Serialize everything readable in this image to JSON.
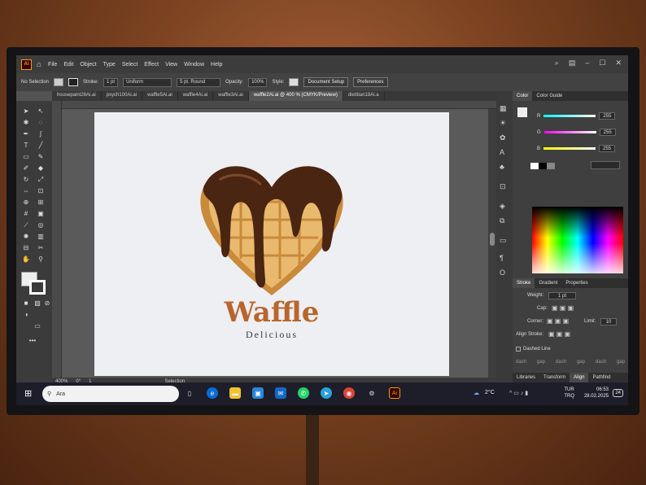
{
  "app": {
    "logo": "Ai"
  },
  "menu": [
    "File",
    "Edit",
    "Object",
    "Type",
    "Select",
    "Effect",
    "View",
    "Window",
    "Help"
  ],
  "control": {
    "selection": "No Selection",
    "stroke_label": "Stroke:",
    "stroke_value": "1 pt",
    "uniform": "Uniform",
    "brush": "5 pt. Round",
    "opacity_label": "Opacity:",
    "opacity_value": "100%",
    "style_label": "Style:",
    "doc_setup": "Document Setup",
    "preferences": "Preferences"
  },
  "tabs": [
    {
      "label": "housepaint26Ai.ai"
    },
    {
      "label": "psych100Ai.ai"
    },
    {
      "label": "waffle5Ai.ai"
    },
    {
      "label": "waffle4Ai.ai"
    },
    {
      "label": "waffle3Ai.ai"
    },
    {
      "label": "waffle2Ai.ai @ 400 % (CMYK/Preview)"
    },
    {
      "label": "dietitian18Ai.a"
    }
  ],
  "artwork": {
    "title": "Waffle",
    "subtitle": "Delicious",
    "colors": {
      "chocolate": "#4a2512",
      "waffle": "#e9b96e",
      "waffle_dark": "#c98a3c",
      "title": "#b8662e",
      "subtitle": "#3a3a3a"
    }
  },
  "color_panel": {
    "tabs": [
      "Color",
      "Color Guide"
    ],
    "r_label": "R",
    "g_label": "G",
    "b_label": "B",
    "r": "255",
    "g": "255",
    "b": "255"
  },
  "stroke_panel": {
    "tabs": [
      "Stroke",
      "Gradient",
      "Properties"
    ],
    "weight_label": "Weight:",
    "weight": "1 pt",
    "cap_label": "Cap:",
    "corner_label": "Corner:",
    "limit_label": "Limit:",
    "limit": "10",
    "align_label": "Align Stroke:",
    "dashed_label": "Dashed Line",
    "dash_labels": [
      "dash",
      "gap",
      "dash",
      "gap",
      "dash",
      "gap"
    ]
  },
  "bottom_tabs": [
    "Libraries",
    "Transform",
    "Align",
    "Pathfind"
  ],
  "status": {
    "zoom": "400%",
    "angle": "0°",
    "page": "1",
    "mode": "Selection"
  },
  "taskbar": {
    "search": "Ara",
    "weather": "2°C",
    "lang_top": "TUR",
    "lang_bottom": "TRQ",
    "time": "06:53",
    "date": "28.02.2025",
    "badge": "24"
  }
}
